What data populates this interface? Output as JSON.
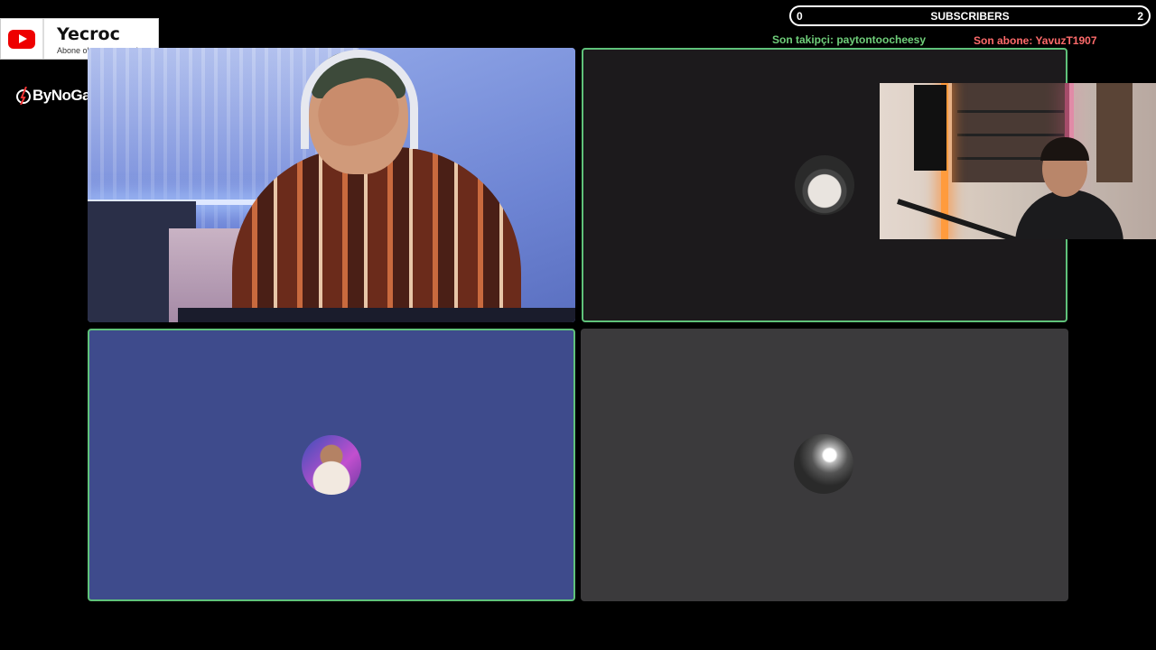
{
  "youtube": {
    "channel_name": "Yecroc",
    "tagline": "Abone olmayı unutma!"
  },
  "sponsor": {
    "label": "ByNoGame"
  },
  "subscribers_bar": {
    "label": "SUBSCRIBERS",
    "current": "0",
    "goal": "2",
    "progress": 0
  },
  "alerts": {
    "last_follower": "Son takipçi: paytontoocheesy",
    "last_subscriber": "Son abone: YavuzT1907"
  },
  "colors": {
    "active_speaker_border": "#5fc27a",
    "follower_text": "#6fcf7a",
    "subscriber_text": "#ff6b6b",
    "tile_blue": "#3e4b8c",
    "tile_dark": "#1c1a1c",
    "tile_gray": "#3b3a3c",
    "youtube_red": "#e00000"
  }
}
